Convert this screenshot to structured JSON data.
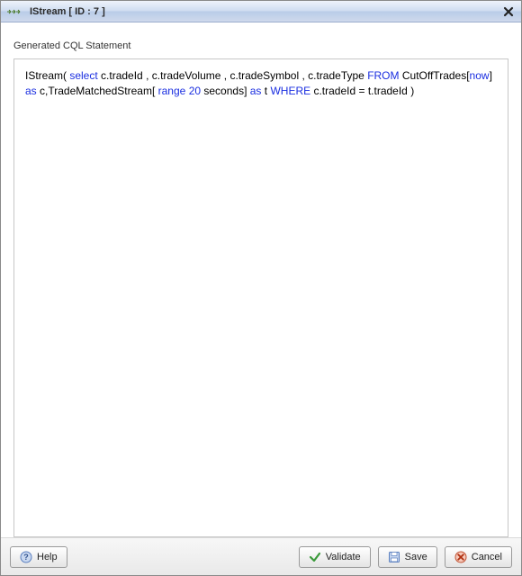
{
  "titlebar": {
    "title": "IStream [ ID : 7 ]"
  },
  "content": {
    "section_label": "Generated CQL Statement",
    "cql_tokens": [
      {
        "t": "txt",
        "v": "IStream( "
      },
      {
        "t": "kw",
        "v": "select"
      },
      {
        "t": "txt",
        "v": "  c.tradeId , c.tradeVolume , c.tradeSymbol , c.tradeType  "
      },
      {
        "t": "kw",
        "v": "FROM"
      },
      {
        "t": "txt",
        "v": " CutOffTrades["
      },
      {
        "t": "kw",
        "v": "now"
      },
      {
        "t": "txt",
        "v": "] "
      },
      {
        "t": "kw",
        "v": "as"
      },
      {
        "t": "txt",
        "v": " c,TradeMatchedStream[ "
      },
      {
        "t": "kw",
        "v": "range"
      },
      {
        "t": "txt",
        "v": " "
      },
      {
        "t": "kw",
        "v": "20"
      },
      {
        "t": "txt",
        "v": " seconds] "
      },
      {
        "t": "kw",
        "v": "as"
      },
      {
        "t": "txt",
        "v": " t "
      },
      {
        "t": "kw",
        "v": "WHERE"
      },
      {
        "t": "txt",
        "v": "  c.tradeId  =  t.tradeId )"
      }
    ]
  },
  "footer": {
    "help_label": "Help",
    "validate_label": "Validate",
    "save_label": "Save",
    "cancel_label": "Cancel"
  },
  "icons": {
    "title": "stream-arrows-icon",
    "close": "close-icon",
    "help": "help-icon",
    "validate": "check-icon",
    "save": "floppy-icon",
    "cancel": "cancel-icon"
  }
}
